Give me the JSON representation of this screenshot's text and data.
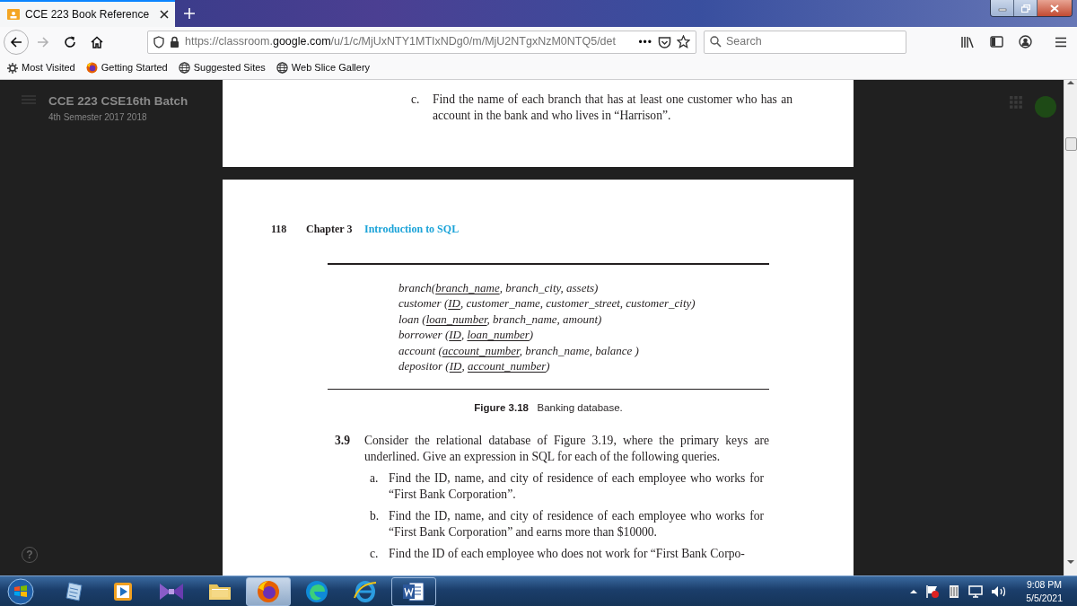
{
  "browser": {
    "tabs": [
      {
        "title": "CCE 223 Book Reference",
        "selected": true
      }
    ],
    "nav_buttons": [
      {
        "kind": "back",
        "disabled": false
      },
      {
        "kind": "forward",
        "disabled": true
      },
      {
        "kind": "reload",
        "disabled": false
      },
      {
        "kind": "home",
        "disabled": false
      }
    ],
    "address": {
      "prefix": "https://classroom.",
      "domain": "google.com",
      "path": "/u/1/c/MjUxNTY1MTIxNDg0/m/MjU2NTgxNzM0NTQ5/det"
    },
    "page_actions": "•••",
    "search": {
      "placeholder": "Search"
    },
    "bookmarks": [
      {
        "label": "Most Visited",
        "kind": "gear"
      },
      {
        "label": "Getting Started",
        "kind": "firefox"
      },
      {
        "label": "Suggested Sites",
        "kind": "globe"
      },
      {
        "label": "Web Slice Gallery",
        "kind": "globe"
      }
    ]
  },
  "classroom": {
    "title": "CCE 223 CSE16th Batch",
    "subtitle": "4th Semester 2017 2018",
    "help": "?"
  },
  "document": {
    "pages": [
      {
        "items": [
          {
            "letter": "c.",
            "text": "Find the name of each branch that has at least one customer who has an account in the bank and who lives in “Harrison”."
          }
        ]
      },
      {
        "header": {
          "page_number": "118",
          "chapter": "Chapter 3",
          "chapter_title": "Introduction to SQL"
        },
        "schema": [
          {
            "segments": [
              {
                "text": "branch(",
                "key": false
              },
              {
                "text": "branch_name",
                "key": true
              },
              {
                "text": ", branch_city, assets)",
                "key": false
              }
            ]
          },
          {
            "segments": [
              {
                "text": "customer (",
                "key": false
              },
              {
                "text": "ID",
                "key": true
              },
              {
                "text": ", customer_name, customer_street, customer_city)",
                "key": false
              }
            ]
          },
          {
            "segments": [
              {
                "text": "loan (",
                "key": false
              },
              {
                "text": "loan_number",
                "key": true
              },
              {
                "text": ", branch_name, amount)",
                "key": false
              }
            ]
          },
          {
            "segments": [
              {
                "text": "borrower (",
                "key": false
              },
              {
                "text": "ID",
                "key": true
              },
              {
                "text": ", ",
                "key": false
              },
              {
                "text": "loan_number",
                "key": true
              },
              {
                "text": ")",
                "key": false
              }
            ]
          },
          {
            "segments": [
              {
                "text": "account (",
                "key": false
              },
              {
                "text": "account_number",
                "key": true
              },
              {
                "text": ", branch_name, balance )",
                "key": false
              }
            ]
          },
          {
            "segments": [
              {
                "text": "depositor (",
                "key": false
              },
              {
                "text": "ID",
                "key": true
              },
              {
                "text": ", ",
                "key": false
              },
              {
                "text": "account_number",
                "key": true
              },
              {
                "text": ")",
                "key": false
              }
            ]
          }
        ],
        "caption": "**Figure 3.18**   Banking database.",
        "exercise": {
          "number": "3.9",
          "text": "Consider the relational database of Figure 3.19, where the primary keys are underlined. Give an expression in SQL for each of the following queries.",
          "items": [
            {
              "letter": "a.",
              "text": "Find the ID, name, and city of residence of each employee who works for “First Bank Corporation”."
            },
            {
              "letter": "b.",
              "text": "Find the ID, name, and city of residence of each employee who works for “First Bank Corporation” and earns more than $10000."
            },
            {
              "letter": "c.",
              "text": "Find the ID of each employee who does not work for “First Bank Corpo-"
            }
          ]
        }
      }
    ]
  },
  "taskbar": {
    "apps": [
      {
        "kind": "notepad",
        "selected": false,
        "running": false
      },
      {
        "kind": "media",
        "selected": false,
        "running": false
      },
      {
        "kind": "bowtie",
        "selected": false,
        "running": false
      },
      {
        "kind": "folder",
        "selected": false,
        "running": false
      },
      {
        "kind": "firefox",
        "selected": true,
        "running": true
      },
      {
        "kind": "edge",
        "selected": false,
        "running": false
      },
      {
        "kind": "ie",
        "selected": false,
        "running": false
      },
      {
        "kind": "word",
        "selected": false,
        "running": true
      }
    ],
    "time": "9:08 PM",
    "date": "5/5/2021"
  }
}
